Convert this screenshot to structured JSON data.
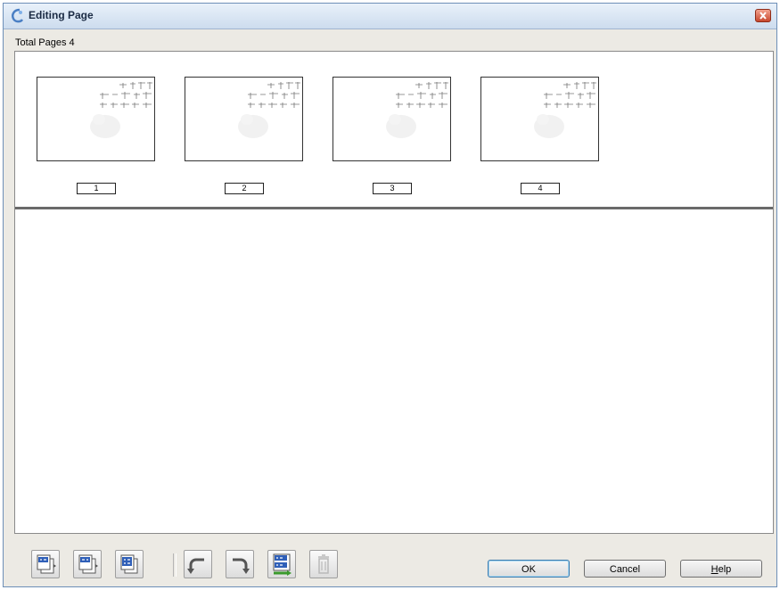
{
  "window": {
    "title": "Editing Page"
  },
  "summary": {
    "total_pages_label": "Total Pages 4"
  },
  "thumbnails": [
    {
      "page": "1"
    },
    {
      "page": "2"
    },
    {
      "page": "3"
    },
    {
      "page": "4"
    }
  ],
  "toolbar": {
    "tools": [
      {
        "name": "select-odd-pages-icon",
        "enabled": true
      },
      {
        "name": "select-even-pages-icon",
        "enabled": true
      },
      {
        "name": "select-all-pages-icon",
        "enabled": true
      },
      {
        "name": "rotate-left-icon",
        "enabled": true
      },
      {
        "name": "rotate-right-icon",
        "enabled": true
      },
      {
        "name": "reorder-pages-icon",
        "enabled": true
      },
      {
        "name": "delete-page-icon",
        "enabled": false
      }
    ],
    "ok_label": "OK",
    "cancel_label": "Cancel",
    "help_label_prefix": "",
    "help_label_hotkey": "H",
    "help_label_rest": "elp"
  },
  "colors": {
    "titlebar": "#cddcee",
    "dialog_bg": "#eceae4",
    "tool_icon_blue": "#2f5fb8",
    "tool_icon_green": "#3a9a2c",
    "close_button": "#c7472d"
  }
}
